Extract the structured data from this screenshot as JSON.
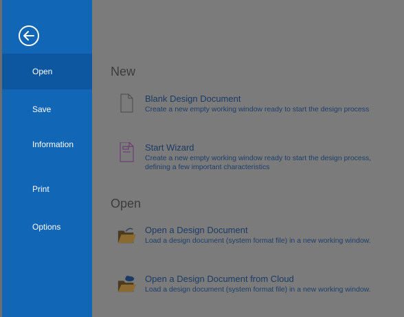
{
  "sidebar": {
    "back_icon": "arrow-left-circle-icon",
    "items": [
      {
        "label": "Open",
        "active": true
      },
      {
        "label": "Save",
        "active": false
      },
      {
        "label": "Information",
        "active": false
      },
      {
        "label": "Print",
        "active": false
      },
      {
        "label": "Options",
        "active": false
      }
    ]
  },
  "main": {
    "new_section": {
      "title": "New",
      "entries": [
        {
          "title": "Blank Design Document",
          "description": "Create a new empty working window ready to start the design process",
          "icon": "blank-document-icon"
        },
        {
          "title": "Start Wizard",
          "description": "Create a new empty working window ready to start the design process, defining a few important characteristics",
          "icon": "wizard-document-icon"
        }
      ]
    },
    "open_section": {
      "title": "Open",
      "entries": [
        {
          "title": "Open a Design Document",
          "description": "Load a design document (system format file) in a new working window.",
          "icon": "open-folder-icon"
        },
        {
          "title": "Open a Design Document from Cloud",
          "description": "Load a design document (system format file) in a new working window.",
          "icon": "cloud-folder-icon"
        }
      ]
    }
  },
  "colors": {
    "sidebar": "#1266b6",
    "sidebar_active": "#0d57a0",
    "content_bg": "#7b7b7b",
    "link_text": "#1a3b66"
  }
}
